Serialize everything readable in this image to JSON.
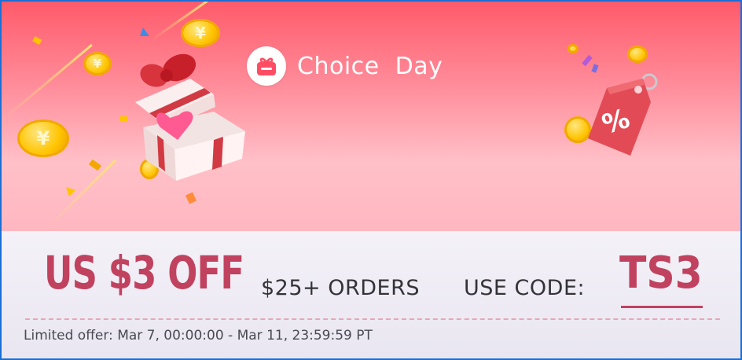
{
  "banner": {
    "title": "Choice  Day",
    "logo_icon": "gift-box-icon",
    "decor_icons": [
      "yen-coin-icon",
      "gift-box-icon",
      "percent-tag-icon",
      "confetti-icon"
    ],
    "coin_symbol": "¥",
    "tag_symbol": "%",
    "colors": {
      "accent": "#c0425f",
      "hero_top": "#ff5b6b",
      "hero_bottom": "#ffb7c0",
      "border": "#1b6fd6"
    }
  },
  "offer": {
    "headline": "US $3 OFF",
    "min_order": "$25+ ORDERS",
    "code_label": "USE CODE:",
    "code": "TS3",
    "validity": "Limited offer: Mar 7, 00:00:00 - Mar 11, 23:59:59 PT"
  }
}
